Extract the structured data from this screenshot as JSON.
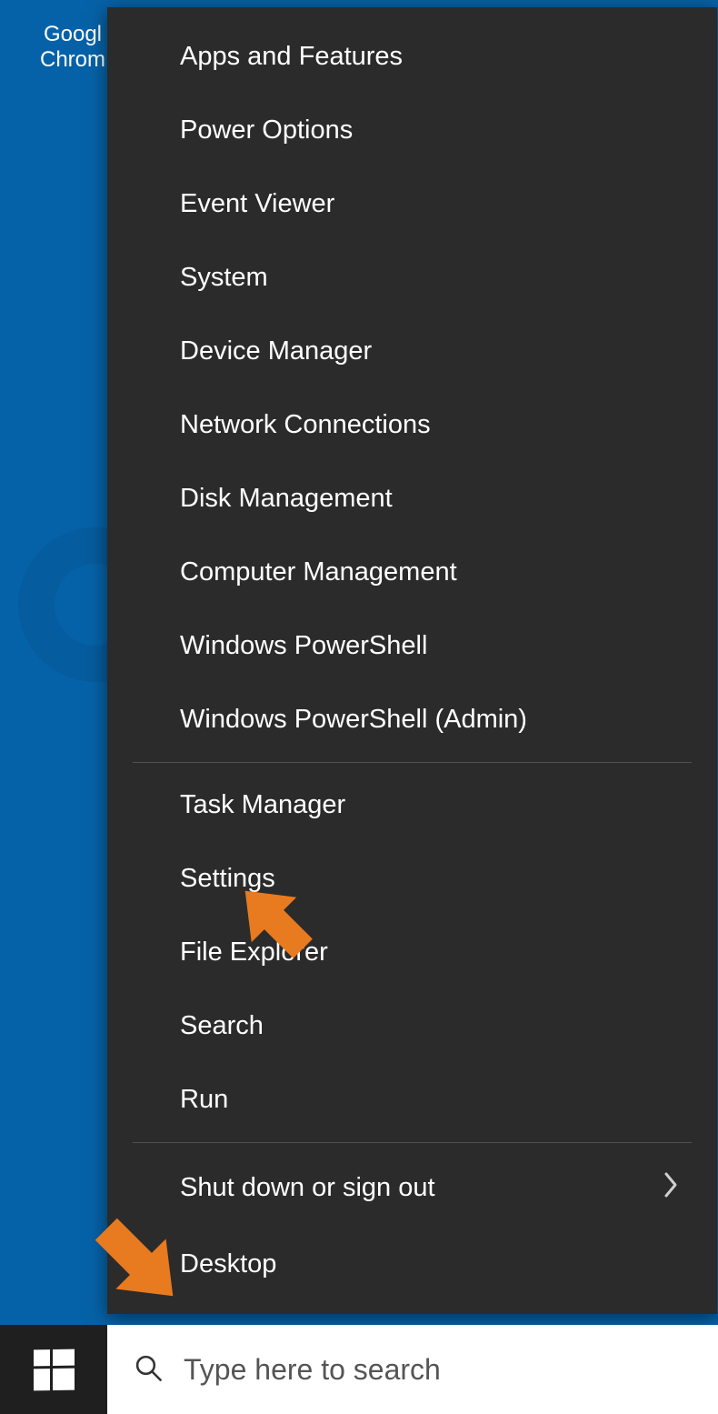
{
  "desktop": {
    "icon_label_line1": "Googl",
    "icon_label_line2": "Chrom"
  },
  "menu": {
    "group1": [
      {
        "label": "Apps and Features"
      },
      {
        "label": "Power Options"
      },
      {
        "label": "Event Viewer"
      },
      {
        "label": "System"
      },
      {
        "label": "Device Manager"
      },
      {
        "label": "Network Connections"
      },
      {
        "label": "Disk Management"
      },
      {
        "label": "Computer Management"
      },
      {
        "label": "Windows PowerShell"
      },
      {
        "label": "Windows PowerShell (Admin)"
      }
    ],
    "group2": [
      {
        "label": "Task Manager"
      },
      {
        "label": "Settings"
      },
      {
        "label": "File Explorer"
      },
      {
        "label": "Search"
      },
      {
        "label": "Run"
      }
    ],
    "group3": [
      {
        "label": "Shut down or sign out",
        "has_submenu": true
      },
      {
        "label": "Desktop"
      }
    ]
  },
  "taskbar": {
    "search_placeholder": "Type here to search"
  },
  "colors": {
    "desktop_bg": "#0662a8",
    "menu_bg": "#2b2b2b",
    "menu_text": "#ffffff",
    "annotation_arrow": "#e87a1f"
  }
}
